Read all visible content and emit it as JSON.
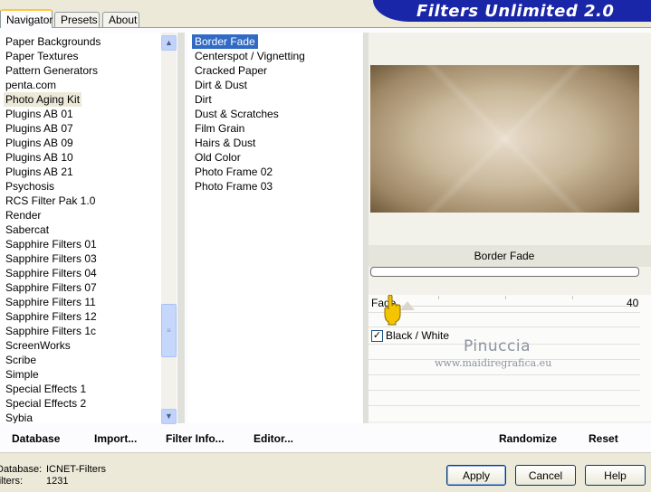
{
  "tabs": [
    {
      "label": "Navigator"
    },
    {
      "label": "Presets"
    },
    {
      "label": "About"
    }
  ],
  "app_title": "Filters Unlimited 2.0",
  "categories": [
    "Paper Backgrounds",
    "Paper Textures",
    "Pattern Generators",
    "penta.com",
    "Photo Aging Kit",
    "Plugins AB 01",
    "Plugins AB 07",
    "Plugins AB 09",
    "Plugins AB 10",
    "Plugins AB 21",
    "Psychosis",
    "RCS Filter Pak 1.0",
    "Render",
    "Sabercat",
    "Sapphire Filters 01",
    "Sapphire Filters 03",
    "Sapphire Filters 04",
    "Sapphire Filters 07",
    "Sapphire Filters 11",
    "Sapphire Filters 12",
    "Sapphire Filters 1c",
    "ScreenWorks",
    "Scribe",
    "Simple",
    "Special Effects 1",
    "Special Effects 2",
    "Sybia"
  ],
  "selected_category": "Photo Aging Kit",
  "filters": [
    "Border Fade",
    "Centerspot / Vignetting",
    "Cracked Paper",
    "Dirt & Dust",
    "Dirt",
    "Dust & Scratches",
    "Film Grain",
    "Hairs & Dust",
    "Old Color",
    "Photo Frame 02",
    "Photo Frame 03"
  ],
  "selected_filter": "Border Fade",
  "preview": {
    "filter_name": "Border Fade"
  },
  "controls": {
    "fade_label": "Fade",
    "fade_value": "40",
    "checkbox_label": "Black / White",
    "checkbox_checked": true,
    "checkbox_mark": "✓"
  },
  "watermark": {
    "line1": "Pinuccia",
    "line2": "www.maidiregrafica.eu"
  },
  "links": {
    "database": "Database",
    "import": "Import...",
    "filter_info": "Filter Info...",
    "editor": "Editor...",
    "randomize": "Randomize",
    "reset": "Reset"
  },
  "info": {
    "database_label": "Database:",
    "database_value": "ICNET-Filters",
    "filters_label": "Filters:",
    "filters_value": "1231"
  },
  "buttons": {
    "apply": "Apply",
    "cancel": "Cancel",
    "help": "Help"
  },
  "icons": {
    "scroll_up": "▲",
    "scroll_down": "▼",
    "thumb_grip": "≡"
  }
}
